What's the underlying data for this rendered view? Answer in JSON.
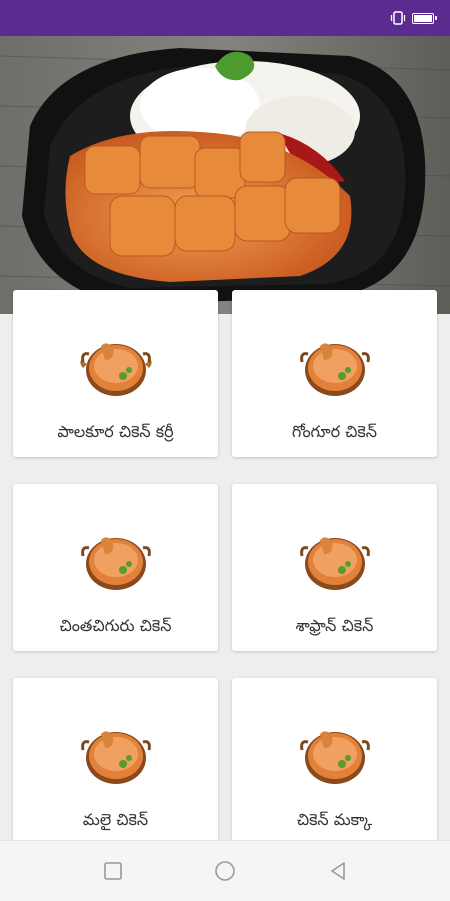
{
  "status_bar": {
    "color": "#5c2b8f",
    "icons": [
      "vibrate-icon",
      "battery-icon"
    ]
  },
  "hero": {
    "image": "chicken-curry-with-rice-photo"
  },
  "recipes": [
    {
      "label": "పాలకూర చికెన్ కర్రీ",
      "icon": "curry-pot-icon"
    },
    {
      "label": "గోంగూర చికెన్",
      "icon": "curry-pot-icon"
    },
    {
      "label": "చింతచిగురు చికెన్",
      "icon": "curry-pot-icon"
    },
    {
      "label": "శాఫ్రాన్ చికెన్",
      "icon": "curry-pot-icon"
    },
    {
      "label": "మలై చికెన్",
      "icon": "curry-pot-icon"
    },
    {
      "label": "చికెన్ మక్కా",
      "icon": "curry-pot-icon"
    }
  ],
  "nav_bar": {
    "buttons": [
      "recents-button",
      "home-button",
      "back-button"
    ]
  }
}
